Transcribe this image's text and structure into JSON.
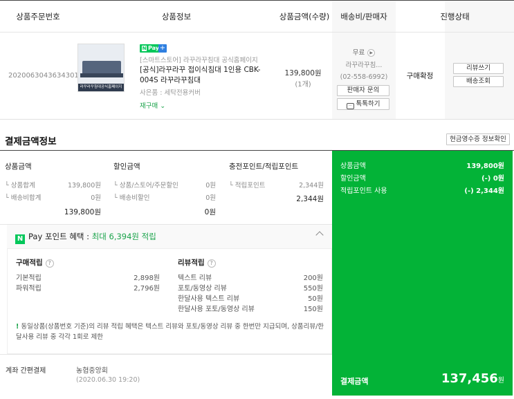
{
  "order_table": {
    "headers": {
      "order_no": "상품주문번호",
      "product_info": "상품정보",
      "amount": "상품금액(수량)",
      "ship_seller": "배송비/판매자",
      "status": "진행상태"
    },
    "row": {
      "order_no": "2020063043634301",
      "thumb_caption": "라꾸라꾸침대공식홈페이지",
      "npay_badge": "Pay",
      "store": "[스마트스토어] 라꾸라꾸침대 공식홈페이지",
      "product_name": "[공식]라꾸라꾸 접이식침대 1인용 CBK-004S 라꾸라꾸침대",
      "option": "사은품 : 세탁전용커버",
      "rebuy": "재구매",
      "price": "139,800원",
      "qty": "(1개)",
      "shipping": "무료",
      "seller": "라꾸라꾸침...",
      "phone": "(02-558-6992)",
      "inquiry_btn": "판매자 문의",
      "talk_btn": "톡톡하기",
      "status": "구매확정",
      "review_btn": "리뷰쓰기",
      "tracking_btn": "배송조회"
    }
  },
  "payment": {
    "title": "결제금액정보",
    "receipt_btn": "현금영수증 정보확인",
    "product_amount": {
      "label": "상품금액",
      "items": [
        {
          "label": "상품합계",
          "value": "139,800원"
        },
        {
          "label": "배송비합계",
          "value": "0원"
        }
      ],
      "total": "139,800원"
    },
    "discount": {
      "label": "할인금액",
      "items": [
        {
          "label": "상품/스토어/주문할인",
          "value": "0원"
        },
        {
          "label": "배송비할인",
          "value": "0원"
        }
      ],
      "total": "0원"
    },
    "points": {
      "label": "충전포인트/적립포인트",
      "items": [
        {
          "label": "적립포인트",
          "value": "2,344원"
        }
      ],
      "total": "2,344원"
    },
    "benefit": {
      "pay_label": "Pay",
      "title": "포인트 혜택 :",
      "highlight": "최대 6,394원 적립",
      "purchase": {
        "title": "구매적립",
        "rows": [
          {
            "label": "기본적립",
            "value": "2,898원"
          },
          {
            "label": "파워적립",
            "value": "2,796원"
          }
        ]
      },
      "review": {
        "title": "리뷰적립",
        "rows": [
          {
            "label": "텍스트 리뷰",
            "value": "200원"
          },
          {
            "label": "포토/동영상 리뷰",
            "value": "550원"
          },
          {
            "label": "한달사용 텍스트 리뷰",
            "value": "50원"
          },
          {
            "label": "한달사용 포토/동영상 리뷰",
            "value": "150원"
          }
        ]
      },
      "note": "동일상품(상품번호 기준)의 리뷰 적립 혜택은 텍스트 리뷰와 포토/동영상 리뷰 중 한번만 지급되며, 상품리뷰/한달사용 리뷰 중 각각 1회로 제한"
    },
    "method": {
      "label": "계좌 간편결제",
      "bank": "농협중앙회",
      "date": "(2020.06.30 19:20)"
    },
    "summary": {
      "rows": [
        {
          "label": "상품금액",
          "value": "139,800원"
        },
        {
          "label": "할인금액",
          "value": "(-) 0원"
        },
        {
          "label": "적립포인트 사용",
          "value": "(-) 2,344원"
        }
      ],
      "total_label": "결제금액",
      "total_value": "137,456",
      "total_unit": "원"
    }
  },
  "colors": {
    "accent_green": "#03b337",
    "naver_green": "#03c75a",
    "text_green": "#1aa34a"
  }
}
